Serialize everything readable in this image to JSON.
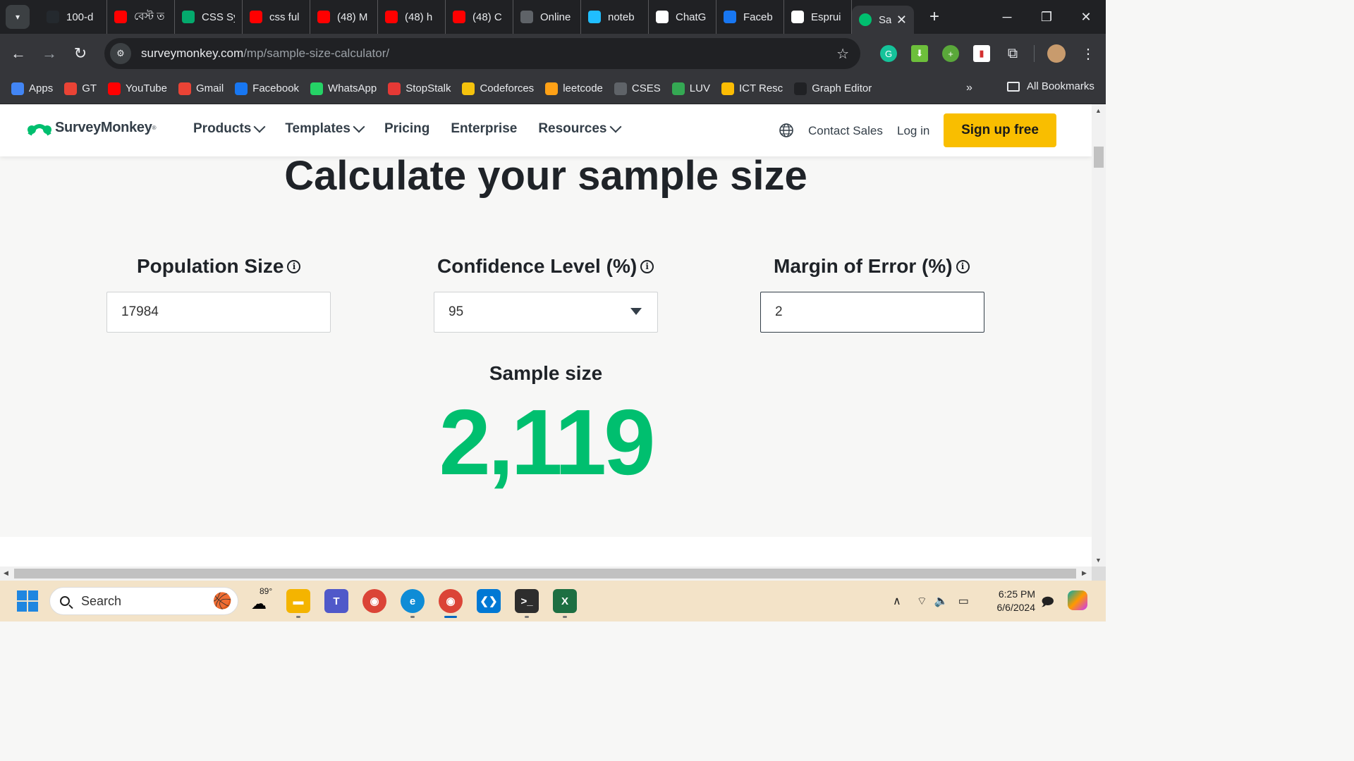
{
  "browser": {
    "tabs": [
      {
        "title": "100-d",
        "icon": "github-icon",
        "color": "#24292e"
      },
      {
        "title": "বেস্ট ত",
        "icon": "youtube-icon",
        "color": "#ff0000"
      },
      {
        "title": "CSS Sy",
        "icon": "w3-icon",
        "color": "#04aa6d"
      },
      {
        "title": "css ful",
        "icon": "youtube-icon",
        "color": "#ff0000"
      },
      {
        "title": "(48) M",
        "icon": "youtube-icon",
        "color": "#ff0000"
      },
      {
        "title": "(48) h",
        "icon": "youtube-icon",
        "color": "#ff0000"
      },
      {
        "title": "(48) C",
        "icon": "youtube-icon",
        "color": "#ff0000"
      },
      {
        "title": "Online",
        "icon": "globe-icon",
        "color": "#5f6368"
      },
      {
        "title": "noteb",
        "icon": "kaggle-icon",
        "color": "#20beff"
      },
      {
        "title": "ChatG",
        "icon": "chatgpt-icon",
        "color": "#ffffff"
      },
      {
        "title": "Faceb",
        "icon": "facebook-icon",
        "color": "#1877f2"
      },
      {
        "title": "Esprui",
        "icon": "espruino-icon",
        "color": "#ffffff"
      }
    ],
    "active_tab": {
      "title": "Sa",
      "icon": "surveymonkey-icon",
      "color": "#00bf6f"
    },
    "url_domain": "surveymonkey.com",
    "url_path": "/mp/sample-size-calculator/",
    "bookmarks": [
      {
        "label": "Apps",
        "icon": "apps-grid-icon",
        "color": "#4285f4"
      },
      {
        "label": "GT",
        "icon": "google-icon",
        "color": "#ea4335"
      },
      {
        "label": "YouTube",
        "icon": "youtube-icon",
        "color": "#ff0000"
      },
      {
        "label": "Gmail",
        "icon": "gmail-icon",
        "color": "#ea4335"
      },
      {
        "label": "Facebook",
        "icon": "facebook-icon",
        "color": "#1877f2"
      },
      {
        "label": "WhatsApp",
        "icon": "whatsapp-icon",
        "color": "#25d366"
      },
      {
        "label": "StopStalk",
        "icon": "stopstalk-icon",
        "color": "#e53935"
      },
      {
        "label": "Codeforces",
        "icon": "codeforces-icon",
        "color": "#f4c20d"
      },
      {
        "label": "leetcode",
        "icon": "leetcode-icon",
        "color": "#ffa116"
      },
      {
        "label": "CSES",
        "icon": "globe-icon",
        "color": "#5f6368"
      },
      {
        "label": "LUV",
        "icon": "luv-icon",
        "color": "#34a853"
      },
      {
        "label": "ICT Resc",
        "icon": "google-drive-icon",
        "color": "#fbbc04"
      },
      {
        "label": "Graph Editor",
        "icon": "graph-icon",
        "color": "#202124"
      }
    ],
    "all_bookmarks": "All Bookmarks"
  },
  "site": {
    "brand": "SurveyMonkey",
    "brand_color": "#00bf6f",
    "nav": [
      {
        "label": "Products",
        "dropdown": true
      },
      {
        "label": "Templates",
        "dropdown": true
      },
      {
        "label": "Pricing",
        "dropdown": false
      },
      {
        "label": "Enterprise",
        "dropdown": false
      },
      {
        "label": "Resources",
        "dropdown": true
      }
    ],
    "contact_sales": "Contact Sales",
    "login": "Log in",
    "signup": "Sign up free",
    "signup_color": "#f9be00"
  },
  "calculator": {
    "title": "Calculate your sample size",
    "population_label": "Population Size",
    "population_value": "17984",
    "confidence_label": "Confidence Level (%)",
    "confidence_value": "95",
    "margin_label": "Margin of Error (%)",
    "margin_value": "2",
    "result_label": "Sample size",
    "result_value": "2,119",
    "result_color": "#00bf6f"
  },
  "taskbar": {
    "search_placeholder": "Search",
    "weather_temp": "89°",
    "time": "6:25 PM",
    "date": "6/6/2024"
  }
}
